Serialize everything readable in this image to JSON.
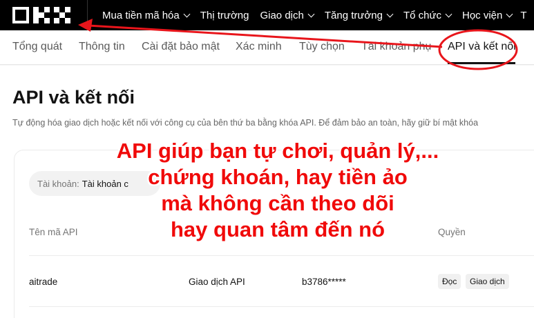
{
  "topnav": {
    "logo_icon": "okx-logo-icon",
    "items": [
      {
        "label": "Mua tiền mã hóa",
        "dropdown": true
      },
      {
        "label": "Thị trường",
        "dropdown": false
      },
      {
        "label": "Giao dịch",
        "dropdown": true
      },
      {
        "label": "Tăng trưởng",
        "dropdown": true
      },
      {
        "label": "Tổ chức",
        "dropdown": true
      },
      {
        "label": "Học viện",
        "dropdown": true
      }
    ],
    "trailing": "T"
  },
  "subtabs": {
    "items": [
      "Tổng quát",
      "Thông tin",
      "Cài đặt bảo mật",
      "Xác minh",
      "Tùy chọn",
      "Tài khoản phụ",
      "API và kết nối"
    ],
    "active": "API và kết nối"
  },
  "page": {
    "title": "API và kết nối",
    "description": "Tự động hóa giao dịch hoặc kết nối với công cụ của bên thứ ba bằng khóa API. Để đảm bảo an toàn, hãy giữ bí mật khóa"
  },
  "account": {
    "label": "Tài khoản:",
    "value": "Tài khoản c"
  },
  "table": {
    "headers": [
      "Tên mã API",
      "",
      "",
      "Quyền"
    ],
    "rows": [
      {
        "name": "aitrade",
        "type": "Giao dịch API",
        "key": "b3786*****",
        "permissions": [
          "Đọc",
          "Giao dịch"
        ]
      }
    ]
  },
  "annotation": {
    "lines": [
      "API giúp bạn tự chơi, quản lý,...",
      "chứng khoán, hay tiền ảo",
      "mà không cần theo dõi",
      "hay quan tâm đến nó"
    ],
    "color": "#f00a0a"
  },
  "colors": {
    "nav_bg": "#000000",
    "highlight": "#e8151b"
  }
}
